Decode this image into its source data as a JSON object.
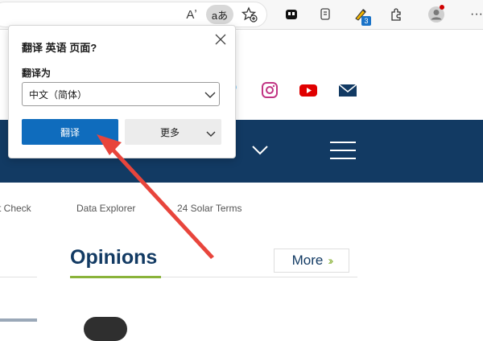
{
  "browser": {
    "translate_chip": "aあ",
    "read_aloud_glyph": "Aʼ",
    "extension_badge": "3",
    "more_glyph": "···"
  },
  "popup": {
    "title": "翻译 英语 页面?",
    "target_label": "翻译为",
    "selected_language": "中文（简体）",
    "translate_button": "翻译",
    "more_button": "更多"
  },
  "page": {
    "subnav": [
      "ct Check",
      "Data Explorer",
      "24 Solar Terms"
    ],
    "section_title": "Opinions",
    "more_link": "More"
  },
  "colors": {
    "nav_bg": "#123a63",
    "accent_green": "#8ab33a",
    "primary_button": "#0f6cbd",
    "annotation_red": "#e8453c"
  }
}
